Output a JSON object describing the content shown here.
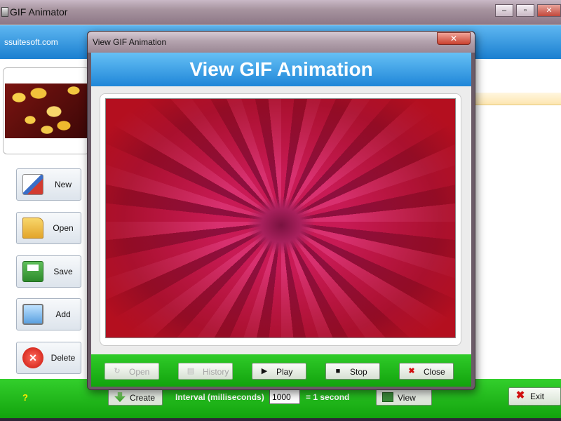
{
  "main_window": {
    "title": "GIF Animator",
    "controls": {
      "minimize": "–",
      "maximize": "▫",
      "close": "✕"
    }
  },
  "brand": {
    "link": "ssuitesoft.com"
  },
  "sidebar": {
    "buttons": [
      {
        "label": "New",
        "icon": "new-document-icon"
      },
      {
        "label": "Open",
        "icon": "folder-icon"
      },
      {
        "label": "Save",
        "icon": "floppy-disk-icon"
      },
      {
        "label": "Add",
        "icon": "monitor-add-icon"
      },
      {
        "label": "Delete",
        "icon": "delete-icon"
      }
    ]
  },
  "bottom_bar": {
    "help": "?",
    "create_label": "Create",
    "interval_label": "Interval (milliseconds)",
    "interval_value": "1000",
    "interval_note": "= 1 second",
    "view_label": "View",
    "exit_label": "Exit"
  },
  "dialog": {
    "title": "View GIF Animation",
    "heading": "View GIF Animation",
    "close_glyph": "✕",
    "buttons": [
      {
        "label": "Open",
        "enabled": false,
        "icon": "open-icon"
      },
      {
        "label": "History",
        "enabled": false,
        "icon": "history-icon"
      },
      {
        "label": "Play",
        "enabled": true,
        "icon": "play-icon"
      },
      {
        "label": "Stop",
        "enabled": true,
        "icon": "stop-icon"
      },
      {
        "label": "Close",
        "enabled": true,
        "icon": "close-x-icon"
      }
    ]
  },
  "colors": {
    "brand_blue": "#1f86d8",
    "toolbar_green": "#12a30d",
    "window_frame": "#9a8794",
    "close_red": "#c9402e"
  }
}
